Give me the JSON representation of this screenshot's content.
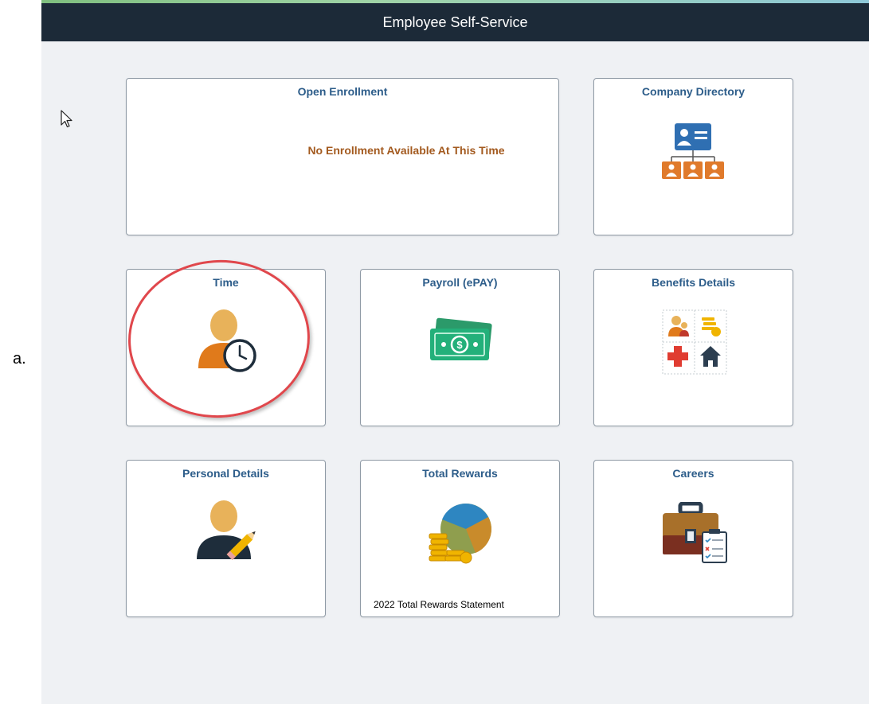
{
  "header": {
    "title": "Employee Self-Service"
  },
  "annotation": {
    "label": "a."
  },
  "tiles": {
    "open_enrollment": {
      "title": "Open Enrollment",
      "message": "No Enrollment Available At This Time"
    },
    "company_directory": {
      "title": "Company Directory",
      "icon": "org-chart-icon"
    },
    "time": {
      "title": "Time",
      "icon": "person-clock-icon"
    },
    "payroll": {
      "title": "Payroll (ePAY)",
      "icon": "money-icon"
    },
    "benefits": {
      "title": "Benefits Details",
      "icon": "benefits-grid-icon"
    },
    "personal": {
      "title": "Personal Details",
      "icon": "person-pencil-icon"
    },
    "rewards": {
      "title": "Total Rewards",
      "icon": "pie-coins-icon",
      "footer": "2022 Total Rewards Statement"
    },
    "careers": {
      "title": "Careers",
      "icon": "briefcase-icon"
    }
  },
  "colors": {
    "header_bg": "#1c2a38",
    "tile_title": "#2d5d8a",
    "message": "#a35a1f",
    "highlight": "#e0474c"
  }
}
